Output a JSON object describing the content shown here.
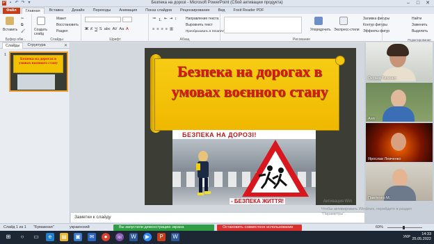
{
  "window": {
    "title": "Безпека на дорозі - Microsoft PowerPoint (Сбой активации продукта)"
  },
  "ribbon_tabs": [
    "Файл",
    "Главная",
    "Вставка",
    "Дизайн",
    "Переходы",
    "Анимация",
    "Показ слайдов",
    "Рецензирование",
    "Вид",
    "Foxit Reader PDF"
  ],
  "ribbon": {
    "clipboard": {
      "paste": "Вставить",
      "label": "Буфер обм..."
    },
    "slides": {
      "new_slide": "Создать слайд",
      "layout": "Макет",
      "reset": "Восстановить",
      "section": "Раздел",
      "label": "Слайды"
    },
    "font": {
      "label": "Шрифт"
    },
    "paragraph": {
      "text_direction": "Направление текста",
      "align_text": "Выровнять текст",
      "smartart": "Преобразовать в SmartArt",
      "label": "Абзац"
    },
    "drawing": {
      "arrange": "Упорядочить",
      "quick_styles": "Экспресс-стили",
      "fill": "Заливка фигуры",
      "outline": "Контур фигуры",
      "effects": "Эффекты фигур",
      "label": "Рисование"
    },
    "editing": {
      "find": "Найти",
      "replace": "Заменить",
      "select": "Выделить",
      "label": "Редактирование"
    }
  },
  "left_panel": {
    "tab_slides": "Слайды",
    "tab_outline": "Структура",
    "thumb_number": "1",
    "thumb_title": "Безпека на дорогах в умовах воєнного стану"
  },
  "slide": {
    "title": "Безпека на дорогах в умовах воєнного стану",
    "image_caption_top": "БЕЗПЕКА НА ДОРОЗІ!",
    "image_caption_bottom": "- БЕЗПЕКА ЖИТТЯ!",
    "watermark": "Активация Win"
  },
  "notes": {
    "placeholder": "Заметки к слайду"
  },
  "participants": [
    {
      "name": "Оксана Тихенко"
    },
    {
      "name": "Аня"
    },
    {
      "name": "Ярослав Левченко"
    },
    {
      "name": "Павленко М."
    }
  ],
  "activation_note": "Чтобы активировать Windows, перейдите в раздел \"Параметры\".",
  "statusbar": {
    "slide_info": "Слайд 1 из 1",
    "theme": "\"Бумажная\"",
    "language": "украинский",
    "share_notice": "Вы запустили демонстрацию экрана",
    "stop_share": "Остановить совместное использование",
    "zoom": "69%"
  },
  "taskbar": {
    "lang": "УКР",
    "time": "14:33",
    "date": "25.05.2022"
  },
  "colors": {
    "file_tab": "#c43e1c",
    "title_red": "#e0141b",
    "scroll_yellow": "#f2c200",
    "share_green": "#2f9e44",
    "stop_red": "#d93030"
  }
}
